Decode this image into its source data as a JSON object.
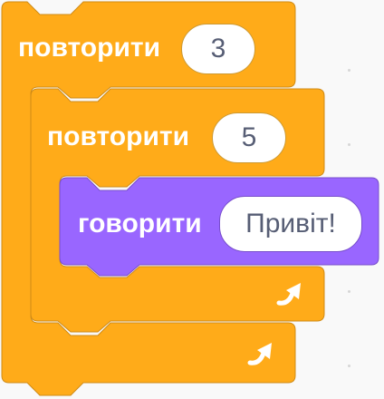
{
  "blocks": {
    "outer_repeat": {
      "label": "повторити",
      "value": "3",
      "color": "#ffab19",
      "border": "#cf8b17"
    },
    "inner_repeat": {
      "label": "повторити",
      "value": "5",
      "color": "#ffab19",
      "border": "#cf8b17"
    },
    "say": {
      "label": "говорити",
      "value": "Привіт!",
      "color": "#9966ff",
      "border": "#774dcb"
    }
  },
  "icons": {
    "loop_arrow": "repeat-arrow-icon"
  }
}
